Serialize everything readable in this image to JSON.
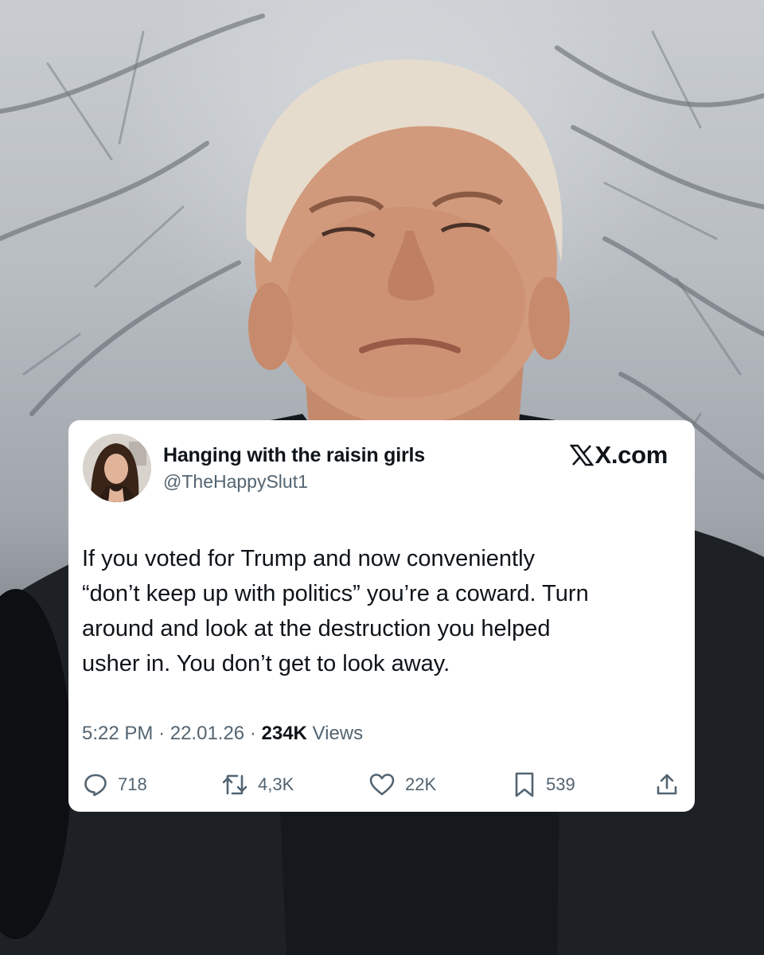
{
  "tweet": {
    "display_name": "Hanging with the raisin girls",
    "handle": "@TheHappySlut1",
    "site_label": "X.com",
    "text_lines": [
      "If you voted for Trump and now conveniently",
      "“don’t keep up with politics” you’re a coward. Turn",
      "around and look at the destruction you helped",
      "usher in. You don’t get to look away."
    ],
    "time": "5:22 PM",
    "date": "22.01.26",
    "views_count": "234K",
    "views_label": "Views",
    "separator": "·"
  },
  "actions": {
    "replies": "718",
    "reposts": "4,3K",
    "likes": "22K",
    "bookmarks": "539"
  },
  "icons": {
    "reply": "reply-icon",
    "repost": "repost-icon",
    "like": "heart-icon",
    "bookmark": "bookmark-icon",
    "share": "share-icon",
    "logo": "x-logo-icon"
  },
  "colors": {
    "card_background": "#ffffff",
    "text_primary": "#0f1419",
    "text_secondary": "#536471"
  }
}
